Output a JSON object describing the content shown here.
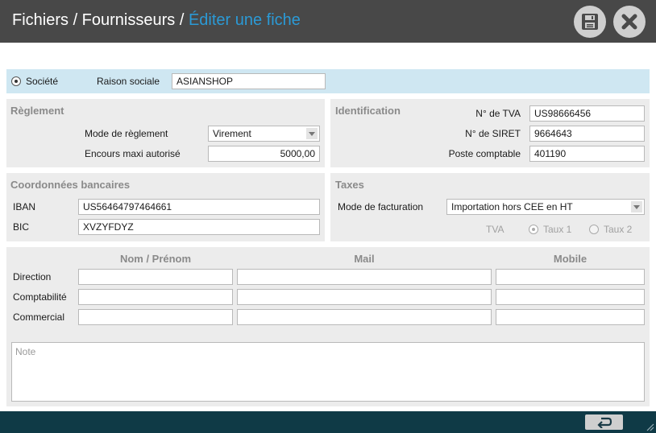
{
  "header": {
    "path_prefix": "Fichiers / Fournisseurs / ",
    "current": "Éditer une fiche",
    "save_icon": "floppy-disk-icon",
    "close_icon": "close-x-icon"
  },
  "societe": {
    "radio_label": "Société",
    "raison_label": "Raison sociale",
    "raison_value": "ASIANSHOP"
  },
  "reglement": {
    "title": "Règlement",
    "mode_label": "Mode de règlement",
    "mode_value": "Virement",
    "encours_label": "Encours maxi autorisé",
    "encours_value": "5000,00"
  },
  "identification": {
    "title": "Identification",
    "tva_label": "N° de TVA",
    "tva_value": "US98666456",
    "siret_label": "N° de SIRET",
    "siret_value": "9664643",
    "poste_label": "Poste comptable",
    "poste_value": "401190"
  },
  "bancaires": {
    "title": "Coordonnées bancaires",
    "iban_label": "IBAN",
    "iban_value": "US56464797464661",
    "bic_label": "BIC",
    "bic_value": "XVZYFDYZ"
  },
  "taxes": {
    "title": "Taxes",
    "facturation_label": "Mode de facturation",
    "facturation_value": "Importation hors CEE en HT",
    "tva_label": "TVA",
    "taux1_label": "Taux 1",
    "taux2_label": "Taux 2"
  },
  "contacts": {
    "col_nom": "Nom / Prénom",
    "col_mail": "Mail",
    "col_mobile": "Mobile",
    "rows": [
      "Direction",
      "Comptabilité",
      "Commercial"
    ],
    "note_placeholder": "Note"
  },
  "colors": {
    "titlebar": "#484848",
    "accent": "#2b9ad6",
    "societe_bar": "#cfe7f2",
    "footer": "#0f3a46"
  }
}
